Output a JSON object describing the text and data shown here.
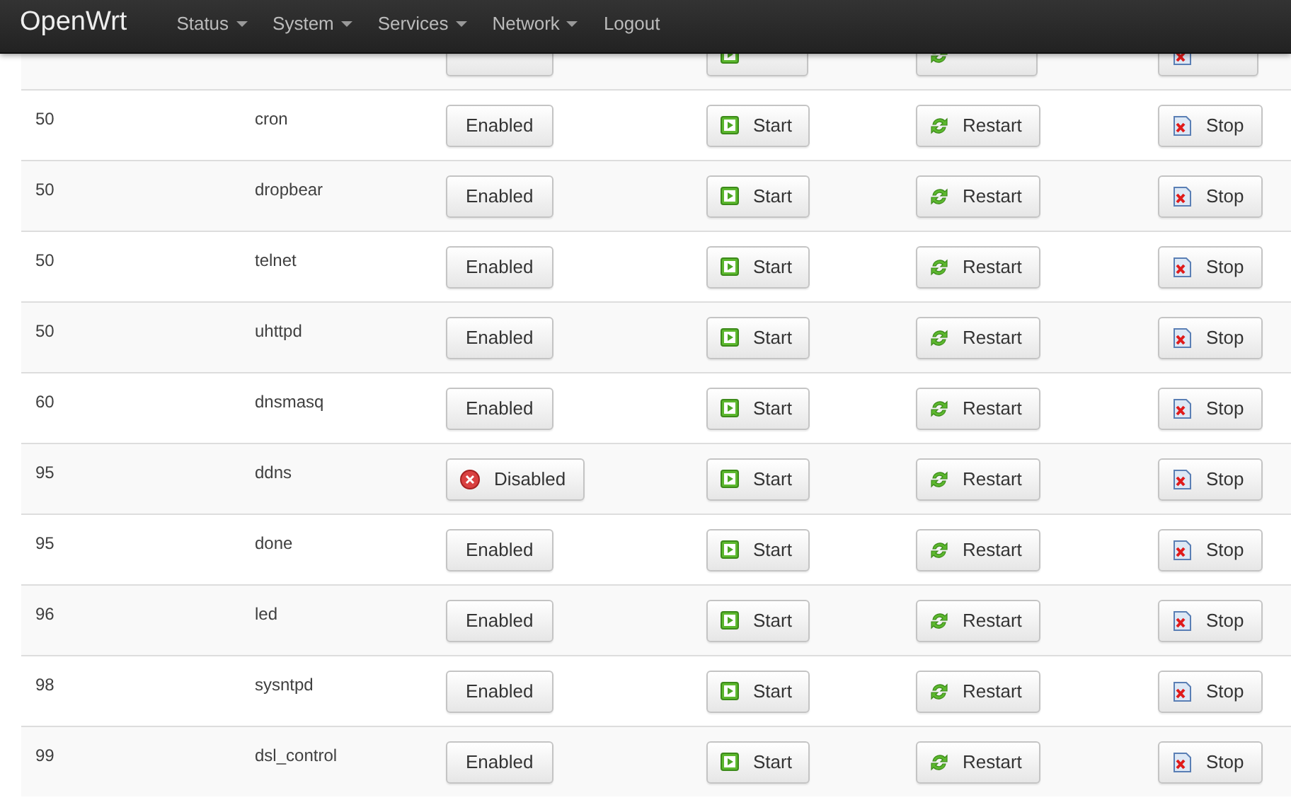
{
  "navbar": {
    "brand": "OpenWrt",
    "menu": [
      {
        "label": "Status",
        "dropdown": true
      },
      {
        "label": "System",
        "dropdown": true
      },
      {
        "label": "Services",
        "dropdown": true
      },
      {
        "label": "Network",
        "dropdown": true
      },
      {
        "label": "Logout",
        "dropdown": false
      }
    ]
  },
  "services": [
    {
      "kind": "partial",
      "enabled": true
    },
    {
      "kind": "row",
      "priority": "50",
      "name": "cron",
      "enabled": true,
      "toggle": "Enabled",
      "start": "Start",
      "restart": "Restart",
      "stop": "Stop"
    },
    {
      "kind": "row",
      "priority": "50",
      "name": "dropbear",
      "enabled": true,
      "toggle": "Enabled",
      "start": "Start",
      "restart": "Restart",
      "stop": "Stop"
    },
    {
      "kind": "row",
      "priority": "50",
      "name": "telnet",
      "enabled": true,
      "toggle": "Enabled",
      "start": "Start",
      "restart": "Restart",
      "stop": "Stop"
    },
    {
      "kind": "row",
      "priority": "50",
      "name": "uhttpd",
      "enabled": true,
      "toggle": "Enabled",
      "start": "Start",
      "restart": "Restart",
      "stop": "Stop"
    },
    {
      "kind": "row",
      "priority": "60",
      "name": "dnsmasq",
      "enabled": true,
      "toggle": "Enabled",
      "start": "Start",
      "restart": "Restart",
      "stop": "Stop"
    },
    {
      "kind": "row",
      "priority": "95",
      "name": "ddns",
      "enabled": false,
      "toggle": "Disabled",
      "start": "Start",
      "restart": "Restart",
      "stop": "Stop"
    },
    {
      "kind": "row",
      "priority": "95",
      "name": "done",
      "enabled": true,
      "toggle": "Enabled",
      "start": "Start",
      "restart": "Restart",
      "stop": "Stop"
    },
    {
      "kind": "row",
      "priority": "96",
      "name": "led",
      "enabled": true,
      "toggle": "Enabled",
      "start": "Start",
      "restart": "Restart",
      "stop": "Stop"
    },
    {
      "kind": "row",
      "priority": "98",
      "name": "sysntpd",
      "enabled": true,
      "toggle": "Enabled",
      "start": "Start",
      "restart": "Restart",
      "stop": "Stop"
    },
    {
      "kind": "row",
      "priority": "99",
      "name": "dsl_control",
      "enabled": true,
      "toggle": "Enabled",
      "start": "Start",
      "restart": "Restart",
      "stop": "Stop"
    }
  ]
}
